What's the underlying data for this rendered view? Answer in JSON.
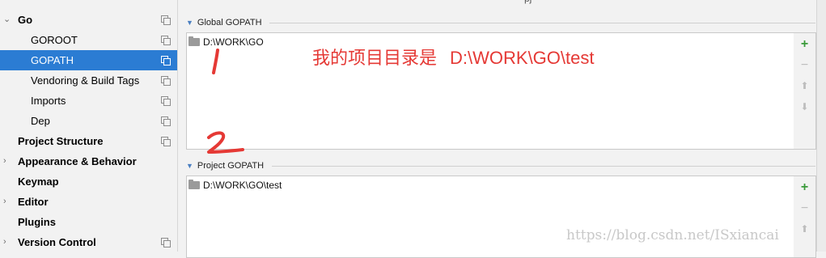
{
  "sidebar": {
    "items": [
      {
        "label": "Go",
        "arrow": "⌄",
        "bold": true,
        "icon": true,
        "selected": false
      },
      {
        "label": "GOROOT",
        "bold": false,
        "icon": true,
        "selected": false
      },
      {
        "label": "GOPATH",
        "bold": false,
        "icon": true,
        "selected": true
      },
      {
        "label": "Vendoring & Build Tags",
        "bold": false,
        "icon": true,
        "selected": false
      },
      {
        "label": "Imports",
        "bold": false,
        "icon": true,
        "selected": false
      },
      {
        "label": "Dep",
        "bold": false,
        "icon": true,
        "selected": false
      },
      {
        "label": "Project Structure",
        "bold": true,
        "icon": true,
        "selected": false
      },
      {
        "label": "Appearance & Behavior",
        "arrow": "›",
        "bold": true,
        "icon": false,
        "selected": false
      },
      {
        "label": "Keymap",
        "bold": true,
        "icon": false,
        "selected": false
      },
      {
        "label": "Editor",
        "arrow": "›",
        "bold": true,
        "icon": false,
        "selected": false
      },
      {
        "label": "Plugins",
        "bold": true,
        "icon": false,
        "selected": false
      },
      {
        "label": "Version Control",
        "arrow": "›",
        "bold": true,
        "icon": true,
        "selected": false
      }
    ],
    "copy_icon": "copy-icon"
  },
  "top_strip": {
    "cut_text": "pj"
  },
  "global_gopath": {
    "title": "Global GOPATH",
    "paths": [
      "D:\\WORK\\GO"
    ]
  },
  "project_gopath": {
    "title": "Project GOPATH",
    "paths": [
      "D:\\WORK\\GO\\test"
    ]
  },
  "toolbar": {
    "add": "+",
    "remove": "−",
    "up": "⬆",
    "down": "⬇"
  },
  "annotation": {
    "text": "我的项目目录是",
    "path": "D:\\WORK\\GO\\test",
    "mark1": "1",
    "mark2": "2",
    "color": "#e53935"
  },
  "watermark": "https://blog.csdn.net/ISxiancai",
  "colors": {
    "selection": "#2b7cd3",
    "add": "#3a9a3a"
  }
}
